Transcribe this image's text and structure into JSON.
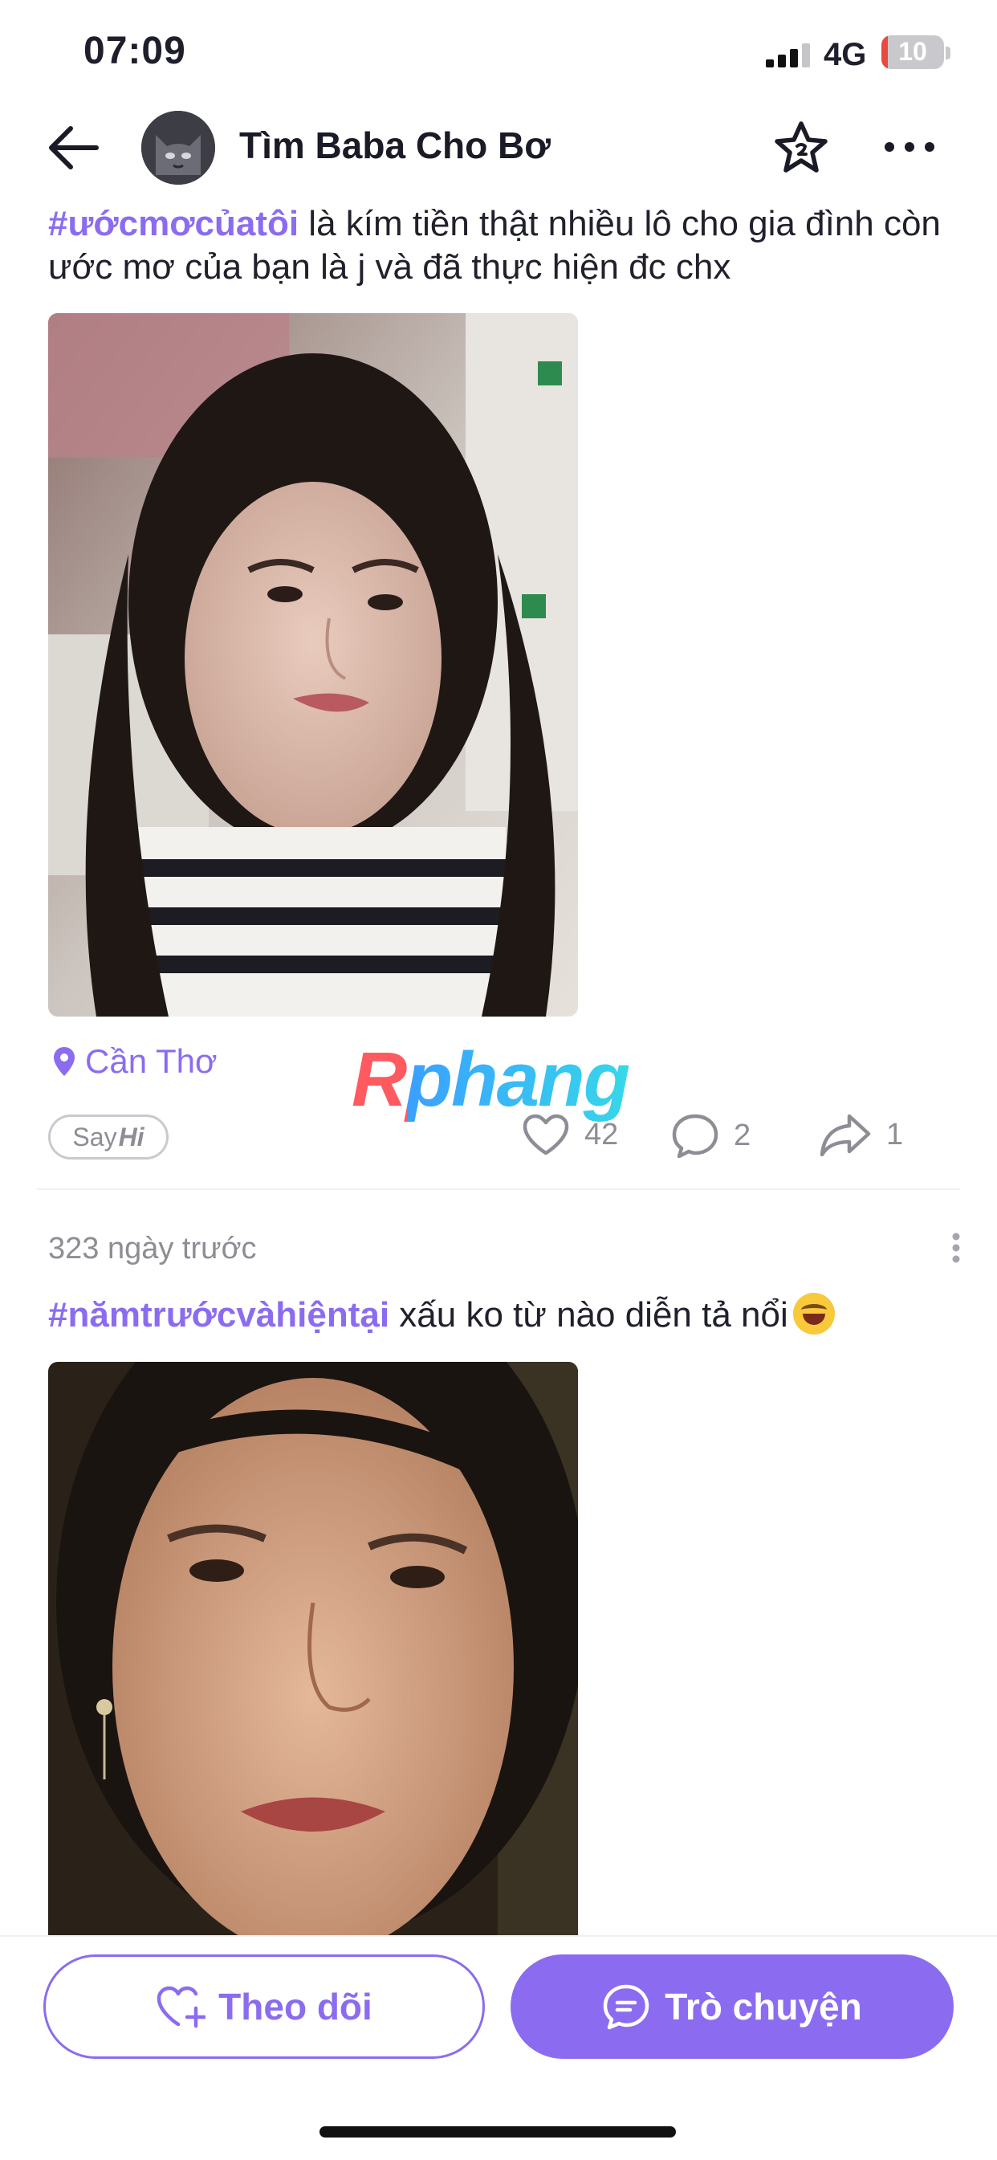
{
  "status_bar": {
    "time": "07:09",
    "network": "4G",
    "battery": "10",
    "battery_level": 0.1,
    "icons": [
      "signal-icon",
      "battery-icon"
    ]
  },
  "header": {
    "title": "Tìm Baba Cho Bơ",
    "icons": [
      "back-arrow-icon",
      "star-icon",
      "more-icon"
    ]
  },
  "posts": [
    {
      "hashtag": "#ướcmơcủatôi",
      "text": " là kím tiền thật nhiều lô cho gia đình còn ước mơ của bạn là j và đã thực hiện đc chx",
      "location": "Cần Thơ",
      "sayhi_prefix": "Say",
      "sayhi_suffix": "Hi",
      "likes": "42",
      "comments": "2",
      "shares": "1"
    },
    {
      "time_ago": "323 ngày trước",
      "hashtag": "#nămtrướcvàhiệntại",
      "text": " xấu ko từ nào diễn tả nổi",
      "emoji": "rolling-laughing-emoji"
    }
  ],
  "watermark": "Rphang",
  "bottom_bar": {
    "follow_label": "Theo dõi",
    "chat_label": "Trò chuyện"
  },
  "colors": {
    "accent": "#8b6cf0",
    "text": "#1e1f2b",
    "muted": "#8d8d96"
  }
}
